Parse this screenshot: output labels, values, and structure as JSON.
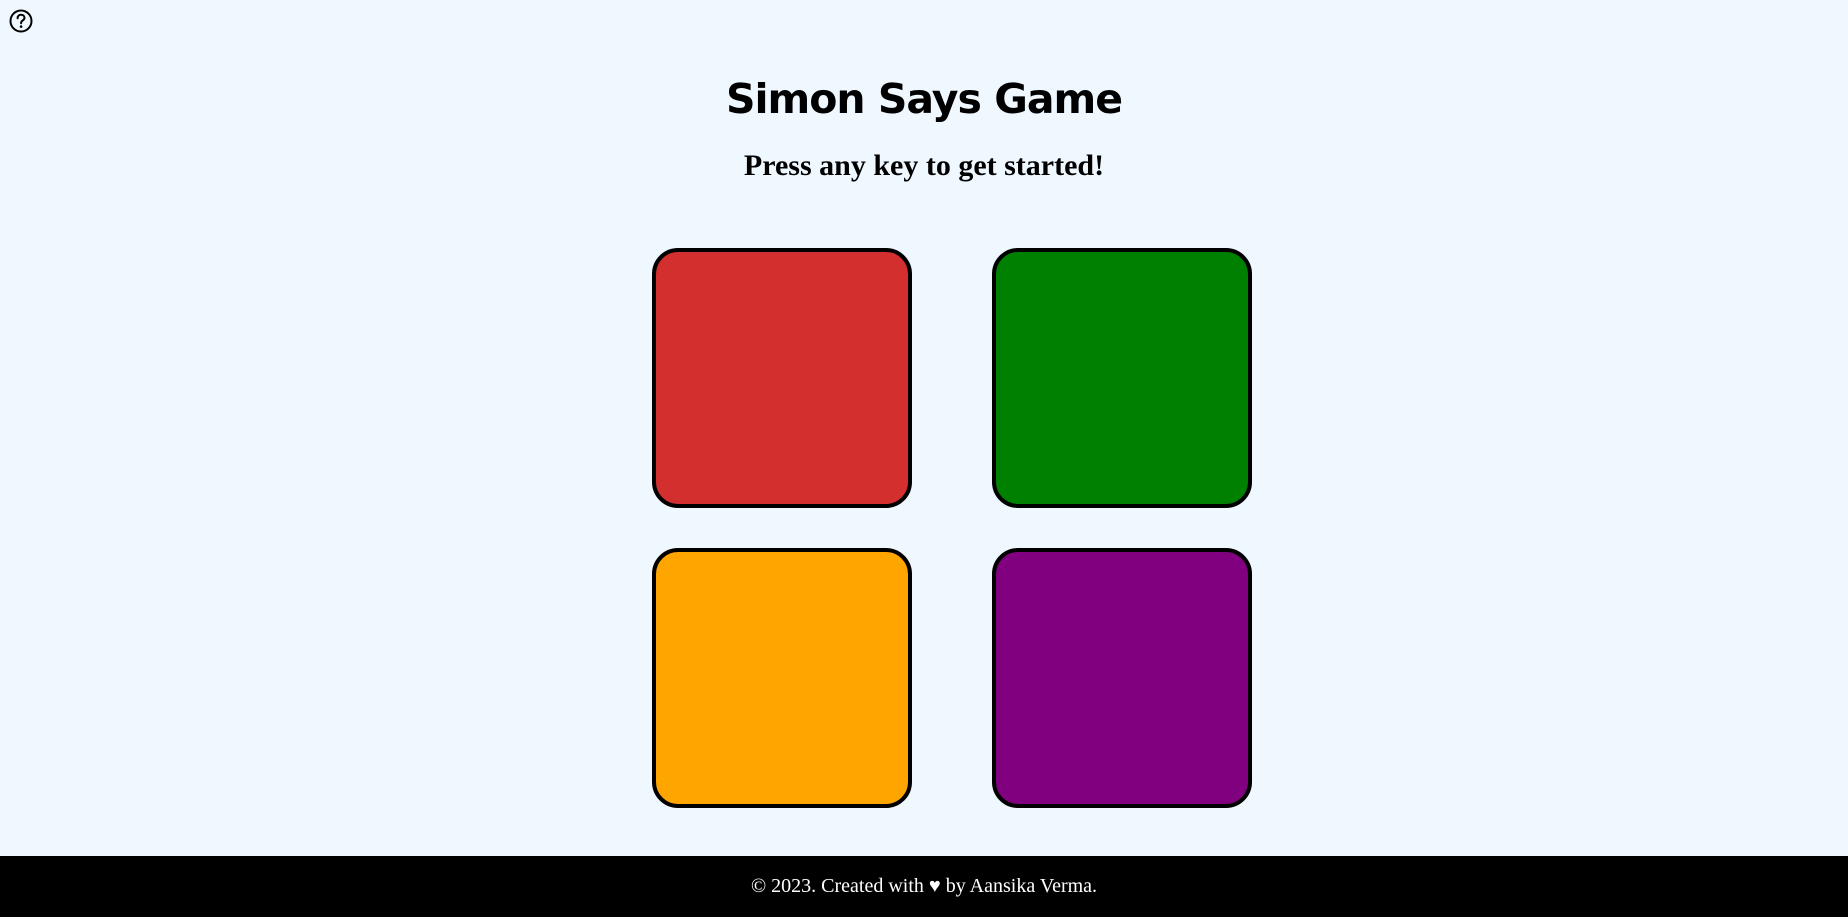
{
  "header": {
    "help_icon": "question-circle-icon",
    "title": "Simon Says Game",
    "status": "Press any key to get started!"
  },
  "pads": [
    {
      "id": "red",
      "color": "#d32f2f"
    },
    {
      "id": "green",
      "color": "#008000"
    },
    {
      "id": "yellow",
      "color": "#ffa500"
    },
    {
      "id": "purple",
      "color": "#800080"
    }
  ],
  "footer": {
    "text": "© 2023. Created with ♥ by Aansika Verma."
  },
  "colors": {
    "background": "#eff7ff",
    "footer_background": "#000000",
    "pad_border": "#000000"
  }
}
